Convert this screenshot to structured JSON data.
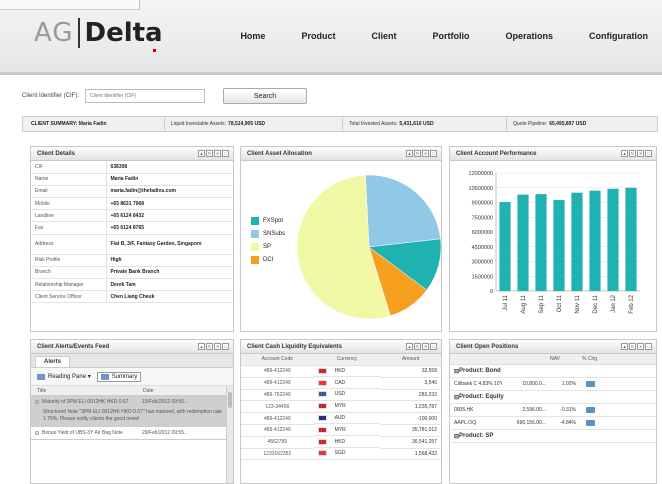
{
  "header": {
    "logo_ag": "AG",
    "logo_delta": "Delta",
    "nav": [
      "Home",
      "Product",
      "Client",
      "Portfolio",
      "Operations",
      "Configuration"
    ]
  },
  "search": {
    "label": "Client Identifier (CIF):",
    "placeholder": "Client Identifier (CIF)",
    "button": "Search"
  },
  "summary": {
    "client_label": "CLIENT SUMMARY: Maria Fadin",
    "liquid_label": "Liquid Investable Assets:",
    "liquid_value": "78,514,905 USD",
    "invested_label": "Total Invested Assets:",
    "invested_value": "5,431,616 USD",
    "pipeline_label": "Quote Pipeline:",
    "pipeline_value": "65,495,897 USD"
  },
  "client_details": {
    "title": "Client Details",
    "rows": [
      {
        "k": "CIF",
        "v": "638308"
      },
      {
        "k": "Name",
        "v": "Maria Fadin"
      },
      {
        "k": "Email",
        "v": "maria.fadin@thefadins.com"
      },
      {
        "k": "Mobile",
        "v": "+65 8631 7968"
      },
      {
        "k": "Landline",
        "v": "+65 6124 8432"
      },
      {
        "k": "Fax",
        "v": "+65 6124 8765"
      },
      {
        "k": "Address",
        "v": "Flat B, 3/F, Fantasy Garden, Singapore"
      },
      {
        "k": "Risk Profile",
        "v": "High"
      },
      {
        "k": "Branch",
        "v": "Private Bank Branch"
      },
      {
        "k": "Relationship Manager",
        "v": "Derek Tam"
      },
      {
        "k": "Client Service Officer",
        "v": "Chen Liang Cheuk"
      }
    ]
  },
  "asset_allocation": {
    "title": "Client Asset Allocation",
    "slices": [
      {
        "name": "FXSpot",
        "value": 12,
        "color": "#1fb2b0"
      },
      {
        "name": "SNSubs",
        "value": 24,
        "color": "#8fc9e6"
      },
      {
        "name": "SP",
        "value": 54,
        "color": "#f1f9a6"
      },
      {
        "name": "DCI",
        "value": 10,
        "color": "#f7a020"
      }
    ]
  },
  "chart_data": {
    "type": "bar",
    "title": "Client Account Performance",
    "categories": [
      "Jul 11",
      "Aug 11",
      "Sep 11",
      "Oct 11",
      "Nov 11",
      "Dec 11",
      "Jan 12",
      "Feb 12"
    ],
    "values": [
      9050000,
      9800000,
      9850000,
      9250000,
      10000000,
      10200000,
      10400000,
      10500000
    ],
    "ylim": [
      0,
      12000000
    ],
    "yticks": [
      "0",
      "1500000",
      "3000000",
      "4500000",
      "6000000",
      "7500000",
      "9000000",
      "10500000",
      "12000000"
    ],
    "bar_color": "#1fb2b0",
    "grid": true
  },
  "alerts": {
    "title": "Client Alerts/Events Feed",
    "tab": "Alerts",
    "reading_pane": "Reading Pane",
    "summary_btn": "Summary",
    "col_title": "Title",
    "col_date": "Date",
    "items": [
      {
        "title": "Maturity of 3PM ELI 0012HK HKD 0.67",
        "date": "15/Feb/2012 09:55...",
        "body": "Structured Note \"3PM ELI 0012HK HKD 0.67\" has matured, with redemption rate 1.75%. Please notify clients the good news!"
      },
      {
        "title": "Bonus Yield of UBS-3Y Air Bag Note",
        "date": "29/Feb/2012 09:55..."
      }
    ]
  },
  "cash": {
    "title": "Client Cash Liquidity Equivalents",
    "headers": [
      "Account Code",
      "Currency",
      "Amount"
    ],
    "rows": [
      {
        "acct": "489-412249",
        "cur": "HKD",
        "amt": "32,558",
        "flag": "#d22"
      },
      {
        "acct": "489-412249",
        "cur": "CAD",
        "amt": "3,546",
        "flag": "#e33"
      },
      {
        "acct": "489-752249",
        "cur": "USD",
        "amt": "283,232",
        "flag": "#3a5ba8"
      },
      {
        "acct": "123-34456",
        "cur": "MYR",
        "amt": "1,235,787",
        "flag": "#c23"
      },
      {
        "acct": "489-412249",
        "cur": "AUD",
        "amt": "-100,000",
        "flag": "#20307a"
      },
      {
        "acct": "489-412249",
        "cur": "MYR",
        "amt": "35,781,012",
        "flag": "#c23"
      },
      {
        "acct": "4562789",
        "cur": "HKD",
        "amt": "36,541,257",
        "flag": "#d22"
      },
      {
        "acct": "1233162352",
        "cur": "SGD",
        "amt": "1,568,432",
        "flag": "#e33"
      }
    ]
  },
  "positions": {
    "title": "Client Open Positions",
    "col_nav": "NAV",
    "col_chg": "% Chg",
    "groups": [
      {
        "name": "Product: Bond",
        "rows": [
          {
            "name": "Citibank C 4.83% 10Y",
            "nav": "10,800.0...",
            "chg": "1.02%"
          }
        ]
      },
      {
        "name": "Product: Equity",
        "rows": [
          {
            "name": "0005.HK",
            "nav": "2,596.00...",
            "chg": "-0.31%"
          },
          {
            "name": "AAPL.OQ",
            "nav": "696,156.00...",
            "chg": "-4.84%"
          }
        ]
      },
      {
        "name": "Product: SP",
        "rows": []
      }
    ]
  }
}
